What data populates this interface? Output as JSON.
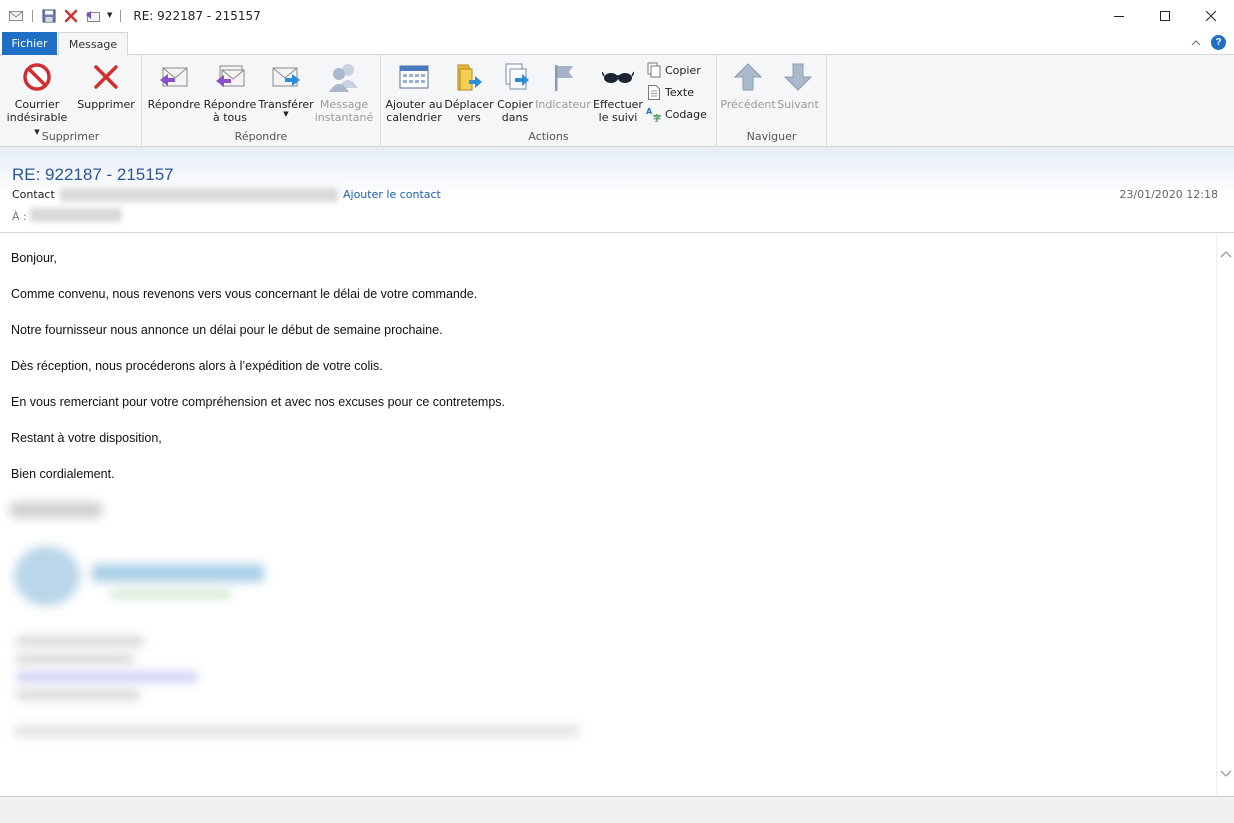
{
  "window": {
    "title": "RE: 922187 - 215157"
  },
  "tabs": [
    {
      "label": "Fichier"
    },
    {
      "label": "Message"
    }
  ],
  "ribbon": {
    "groups": {
      "supprimer": {
        "label": "Supprimer",
        "buttons": [
          {
            "line1": "Courrier",
            "line2": "indésirable"
          },
          {
            "line1": "Supprimer",
            "line2": ""
          }
        ]
      },
      "repondre": {
        "label": "Répondre",
        "buttons": [
          {
            "line1": "Répondre",
            "line2": ""
          },
          {
            "line1": "Répondre",
            "line2": "à tous"
          },
          {
            "line1": "Transférer",
            "line2": ""
          },
          {
            "line1": "Message",
            "line2": "instantané"
          }
        ]
      },
      "actions": {
        "label": "Actions",
        "buttons": [
          {
            "line1": "Ajouter au",
            "line2": "calendrier"
          },
          {
            "line1": "Déplacer",
            "line2": "vers"
          },
          {
            "line1": "Copier",
            "line2": "dans"
          },
          {
            "line1": "Indicateur",
            "line2": ""
          },
          {
            "line1": "Effectuer",
            "line2": "le suivi"
          }
        ],
        "small": [
          {
            "label": "Copier"
          },
          {
            "label": "Texte"
          },
          {
            "label": "Codage"
          }
        ]
      },
      "naviguer": {
        "label": "Naviguer",
        "buttons": [
          {
            "line1": "Précédent",
            "line2": ""
          },
          {
            "line1": "Suivant",
            "line2": ""
          }
        ]
      }
    }
  },
  "message": {
    "subject": "RE: 922187 - 215157",
    "from_label": "Contact",
    "add_contact": "Ajouter le contact",
    "date": "23/01/2020 12:18",
    "to_label": "À :",
    "body": [
      "Bonjour,",
      "Comme convenu, nous revenons vers vous concernant le délai de votre commande.",
      "Notre fournisseur nous annonce un délai pour le début de semaine prochaine.",
      "Dès réception, nous procéderons alors à l’expédition de votre colis.",
      "En vous remerciant pour votre compréhension et avec nos excuses pour ce contretemps.",
      "Restant à votre disposition,",
      "Bien cordialement."
    ]
  },
  "colors": {
    "accent": "#1f6fc5",
    "subject": "#2b5797",
    "link": "#1a5fb4"
  }
}
